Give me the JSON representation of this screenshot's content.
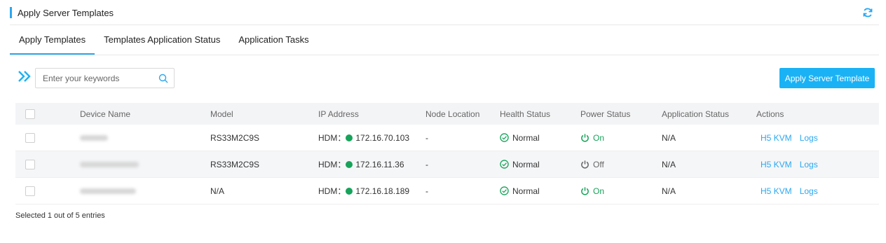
{
  "header": {
    "title": "Apply Server Templates"
  },
  "tabs": [
    {
      "label": "Apply Templates"
    },
    {
      "label": "Templates Application Status"
    },
    {
      "label": "Application Tasks"
    }
  ],
  "search": {
    "placeholder": "Enter your keywords"
  },
  "apply_button": {
    "label": "Apply Server Template"
  },
  "table": {
    "headers": {
      "device_name": "Device Name",
      "model": "Model",
      "ip_address": "IP Address",
      "node_location": "Node Location",
      "health_status": "Health Status",
      "power_status": "Power Status",
      "application_status": "Application Status",
      "actions": "Actions"
    },
    "rows": [
      {
        "model": "RS33M2C9S",
        "ip_prefix": "HDM：",
        "ip": "172.16.70.103",
        "node_location": "-",
        "health": "Normal",
        "power": "On",
        "application_status": "N/A",
        "action_kvm": "H5 KVM",
        "action_logs": "Logs"
      },
      {
        "model": "RS33M2C9S",
        "ip_prefix": "HDM：",
        "ip": "172.16.11.36",
        "node_location": "-",
        "health": "Normal",
        "power": "Off",
        "application_status": "N/A",
        "action_kvm": "H5 KVM",
        "action_logs": "Logs"
      },
      {
        "model": "N/A",
        "ip_prefix": "HDM：",
        "ip": "172.16.18.189",
        "node_location": "-",
        "health": "Normal",
        "power": "On",
        "application_status": "N/A",
        "action_kvm": "H5 KVM",
        "action_logs": "Logs"
      }
    ]
  },
  "footer": {
    "selection_text": "Selected 1 out of 5 entries"
  },
  "colors": {
    "accent": "#2aa7f0",
    "button": "#1ab2f5",
    "success": "#17a35a"
  }
}
